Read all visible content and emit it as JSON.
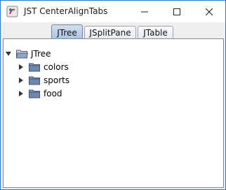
{
  "window": {
    "title": "JST CenterAlignTabs",
    "icons": {
      "app": "java-app-icon",
      "minimize": "minimize-icon",
      "maximize": "maximize-icon",
      "close": "close-icon"
    }
  },
  "tabs": [
    {
      "label": "JTree",
      "selected": true
    },
    {
      "label": "JSplitPane",
      "selected": false
    },
    {
      "label": "JTable",
      "selected": false
    }
  ],
  "tree": {
    "root": {
      "label": "JTree",
      "expanded": true,
      "icon": "folder-open-icon"
    },
    "children": [
      {
        "label": "colors",
        "expanded": false,
        "icon": "folder-icon"
      },
      {
        "label": "sports",
        "expanded": false,
        "icon": "folder-icon"
      },
      {
        "label": "food",
        "expanded": false,
        "icon": "folder-icon"
      }
    ]
  }
}
